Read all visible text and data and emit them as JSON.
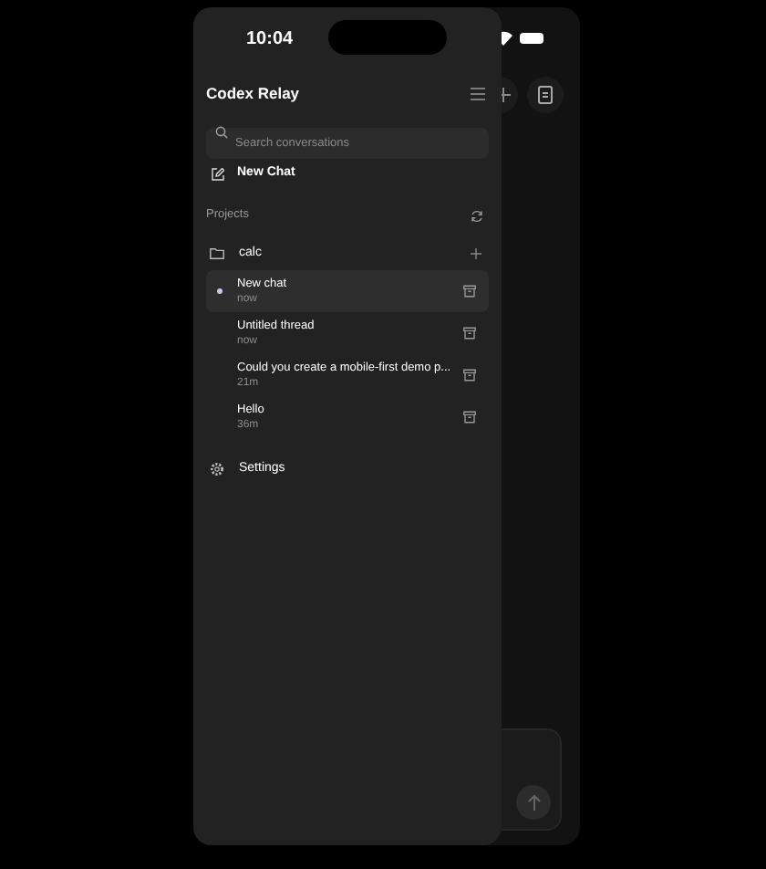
{
  "status_bar": {
    "time": "10:04"
  },
  "sidebar": {
    "title": "Codex Relay",
    "search": {
      "placeholder": "Search conversations"
    },
    "new_chat": "New Chat",
    "section_label": "Projects",
    "project": {
      "name": "calc"
    },
    "threads": [
      {
        "title": "New chat",
        "time": "now",
        "selected": true
      },
      {
        "title": "Untitled thread",
        "time": "now",
        "selected": false
      },
      {
        "title": "Could you create a mobile-first demo p...",
        "time": "21m",
        "selected": false
      },
      {
        "title": "Hello",
        "time": "36m",
        "selected": false
      }
    ],
    "settings": "Settings"
  }
}
